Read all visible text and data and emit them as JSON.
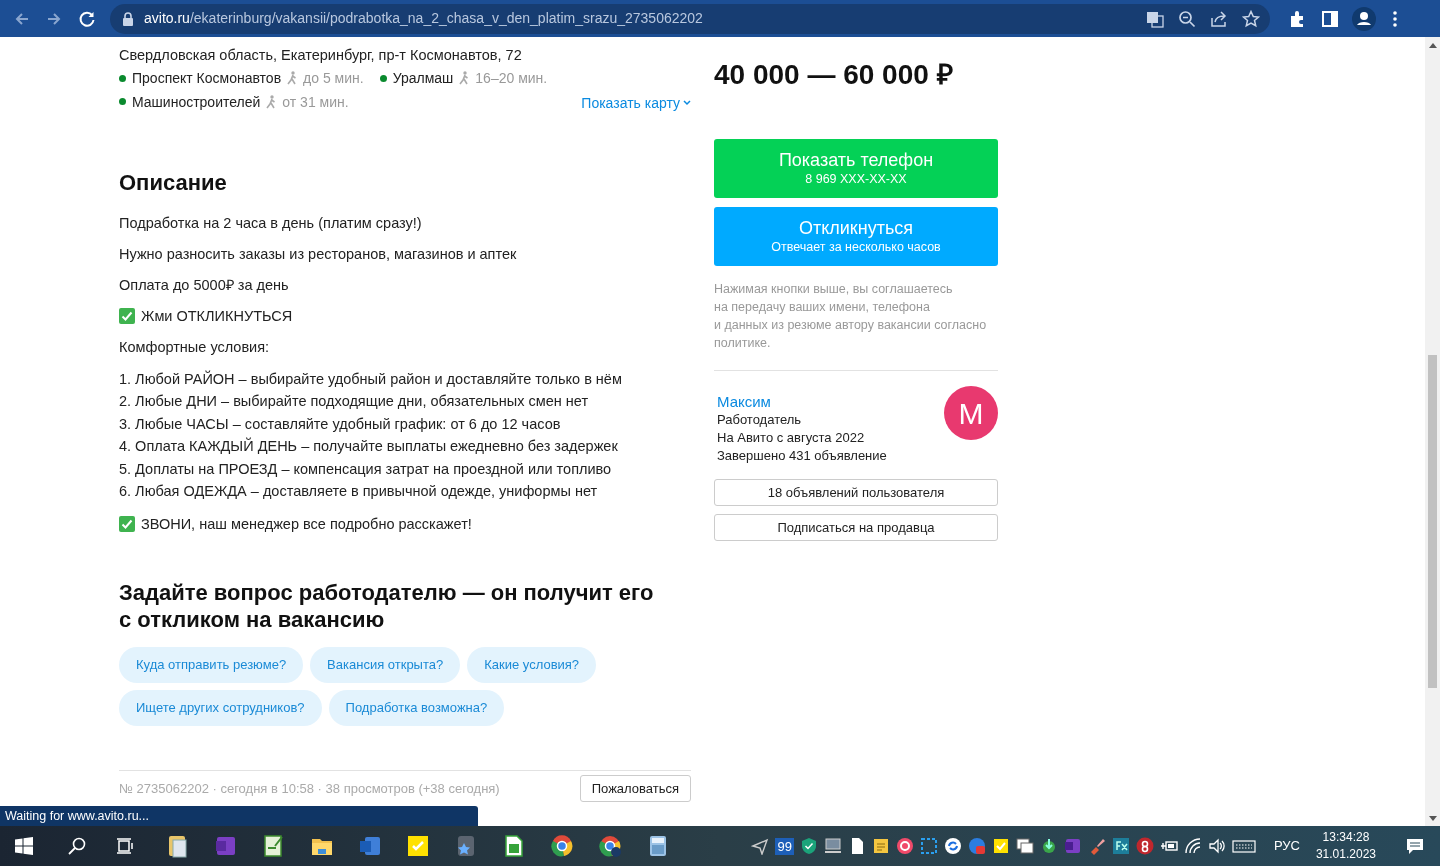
{
  "browser": {
    "url_domain": "avito.ru",
    "url_path": "/ekaterinburg/vakansii/podrabotka_na_2_chasa_v_den_platim_srazu_2735062202"
  },
  "address": "Свердловская область, Екатеринбург, пр-т Космонавтов, 72",
  "metro": [
    {
      "name": "Проспект Космонавтов",
      "time": "до 5 мин.",
      "color": "#0a8a2e"
    },
    {
      "name": "Уралмаш",
      "time": "16–20 мин.",
      "color": "#0a8a2e"
    },
    {
      "name": "Машиностроителей",
      "time": "от 31 мин.",
      "color": "#0a8a2e"
    }
  ],
  "show_map": "Показать карту",
  "description_title": "Описание",
  "description": [
    {
      "kind": "para",
      "text": "Подработка на 2 часа в день (платим сразу!)"
    },
    {
      "kind": "para",
      "text": "Нужно разносить заказы из ресторанов, магазинов и аптек"
    },
    {
      "kind": "para",
      "text": "Оплата до 5000₽ за день"
    },
    {
      "kind": "check",
      "text": "Жми ОТКЛИКНУТЬСЯ"
    },
    {
      "kind": "para",
      "text": "Комфортные условия:"
    },
    {
      "kind": "list",
      "items": [
        "1. Любой РАЙОН – выбирайте удобный район и доставляйте только в нём",
        "2. Любые ДНИ – выбирайте подходящие дни, обязательных смен нет",
        "3. Любые ЧАСЫ – составляйте удобный график: от 6 до 12 часов",
        "4. Оплата КАЖДЫЙ ДЕНЬ – получайте выплаты ежедневно без задержек",
        "5. Доплаты на ПРОЕЗД – компенсация затрат на проездной или топливо",
        "6. Любая ОДЕЖДА – доставляете в привычной одежде, униформы нет"
      ]
    },
    {
      "kind": "check",
      "text": "ЗВОНИ, наш менеджер все подробно расскажет!"
    }
  ],
  "question_title": "Задайте вопрос работодателю — он получит его с откликом на вакансию",
  "questions": [
    "Куда отправить резюме?",
    "Вакансия открыта?",
    "Какие условия?",
    "Ищете других сотрудников?",
    "Подработка возможна?"
  ],
  "footer": {
    "meta": "№ 2735062202 · сегодня в 10:58 · 38 просмотров (+38 сегодня)",
    "report": "Пожаловаться"
  },
  "price": "40 000 — 60 000 ₽",
  "phone_button": {
    "title": "Показать телефон",
    "subtitle": "8 969 XXX-XX-XX"
  },
  "respond_button": {
    "title": "Откликнуться",
    "subtitle": "Отвечает за несколько часов"
  },
  "disclaimer": "Нажимая кнопки выше, вы соглашаетесь\nна передачу ваших имени, телефона\nи данных из резюме автору вакансии согласно политике.",
  "seller": {
    "name": "Максим",
    "role": "Работодатель",
    "since": "На Авито с августа 2022",
    "completed": "Завершено 431 объявление",
    "avatar_letter": "М"
  },
  "seller_buttons": [
    "18 объявлений пользователя",
    "Подписаться на продавца"
  ],
  "status_bubble": "Waiting for www.avito.ru...",
  "taskbar": {
    "tray_badge": "99",
    "language": "РУС",
    "time": "13:34:28",
    "date": "31.01.2023"
  }
}
